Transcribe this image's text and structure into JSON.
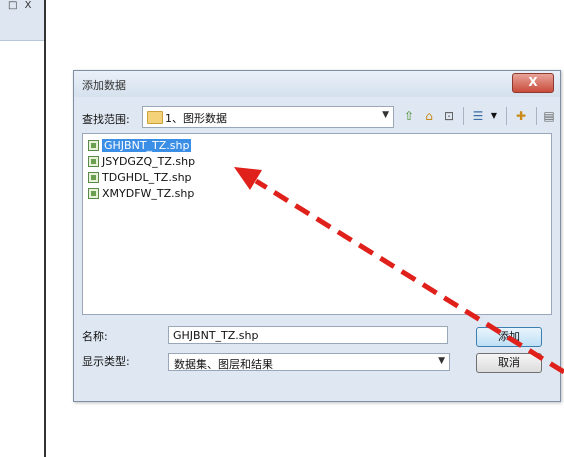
{
  "background_window": {
    "controls": "□ X"
  },
  "dialog": {
    "title": "添加数据",
    "close_label": "X",
    "look_in_label": "查找范围:",
    "look_in_value": "1、图形数据",
    "files": [
      {
        "name": "GHJBNT_TZ.shp",
        "selected": true
      },
      {
        "name": "JSYDGZQ_TZ.shp",
        "selected": false
      },
      {
        "name": "TDGHDL_TZ.shp",
        "selected": false
      },
      {
        "name": "XMYDFW_TZ.shp",
        "selected": false
      }
    ],
    "name_label": "名称:",
    "name_value": "GHJBNT_TZ.shp",
    "type_label": "显示类型:",
    "type_value": "数据集、图层和结果",
    "add_button": "添加",
    "cancel_button": "取消"
  },
  "colors": {
    "annotation_arrow": "#e0201a",
    "selection": "#3a8ee6"
  },
  "icons": [
    "folder-icon",
    "up-folder-icon",
    "home-icon",
    "connect-icon",
    "view-icon",
    "new-folder-icon",
    "catalog-icon",
    "shapefile-icon"
  ]
}
